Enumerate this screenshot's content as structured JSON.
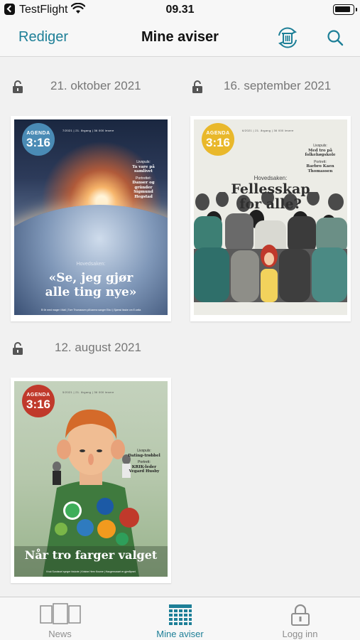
{
  "status_bar": {
    "back_app": "TestFlight",
    "time": "09.31"
  },
  "nav": {
    "edit_label": "Rediger",
    "title": "Mine aviser",
    "trash_icon": "trash-sync-icon",
    "search_icon": "search-icon"
  },
  "issues": [
    {
      "date": "21. oktober 2021",
      "cover": {
        "badge_small": "AGENDA",
        "badge_big": "3:16",
        "badge_color": "#4a8bb5",
        "meta": "7/2021  |  21. årgang  |  36 000 lesere",
        "side_kicker": "Livspuls:",
        "side_text": "Ta vare på samlivet",
        "side_kicker2": "Portrettet:",
        "side_text2": "Danser og gründer Sigmund Hegstad",
        "kicker": "Hovedsaken:",
        "headline": "«Se, jeg gjør alle ting nye»",
        "footer": "Et år med mager i Mali  |  Tore Thomassen på karma sanger Elia i  |  Sjømsl lisske om E-selia"
      }
    },
    {
      "date": "16. september 2021",
      "cover": {
        "badge_small": "AGENDA",
        "badge_big": "3:16",
        "badge_color": "#e9b82b",
        "meta": "6/2021  |  21. årgang  |  36 000 lesere",
        "side_kicker": "Livspuls:",
        "side_text": "Med tro på folkehøgskole",
        "side_kicker2": "Portrett:",
        "side_text2": "Barbro Kaen Thomassen",
        "kicker": "Hovedsaken:",
        "headline": "Fellesskap for alle?",
        "footer": "Slipp unge til i menigheten  |  Svenske misjonsbrodoms i ny bok  |  Nordiske spisgrupper"
      }
    },
    {
      "date": "12. august 2021",
      "cover": {
        "badge_small": "AGENDA",
        "badge_big": "3:16",
        "badge_color": "#c0392b",
        "meta": "5/2021  |  21. årgang  |  36 000 lesere",
        "side_kicker": "Livspuls:",
        "side_text": "Dating-trøbbel",
        "side_kicker2": "Portrett:",
        "side_text2": "KRIK-leder Vegard Husby",
        "kicker": "",
        "headline": "Når tro farger valget",
        "footer": "Knut Sundsvei synger historie  |  Kristne Hem Knume  |  Haugemusset er gjenåpnet"
      }
    }
  ],
  "tabs": [
    {
      "label": "News",
      "icon": "newspapers-icon"
    },
    {
      "label": "Mine aviser",
      "icon": "grid-calendar-icon"
    },
    {
      "label": "Logg inn",
      "icon": "padlock-icon"
    }
  ],
  "colors": {
    "accent": "#1d7f97",
    "inactive": "#8e8e8e"
  }
}
